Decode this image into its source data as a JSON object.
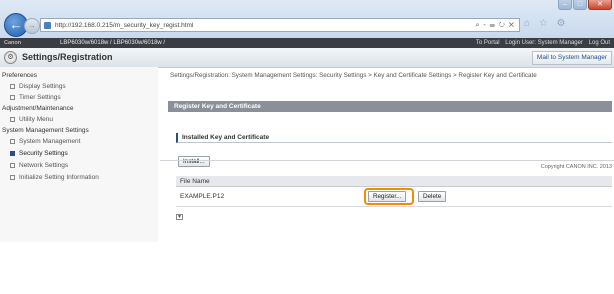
{
  "browser": {
    "url": "http://192.168.0.215/m_security_key_regist.html",
    "address_tools": "⌕ - ☰ ↻ ✕",
    "window_controls": {
      "minimize": "–",
      "maximize": "□",
      "close": "✕"
    },
    "toolbar_icons": "⌂ ☆ ⚙"
  },
  "header": {
    "logo": "Canon",
    "device": "LBP6030w/6018w / LBP6030w/6018w /",
    "to_portal": "To Portal",
    "login_user": "Login User: System Manager",
    "log_out": "Log Out"
  },
  "title_bar": {
    "title": "Settings/Registration",
    "mail_button": "Mail to System Manager"
  },
  "sidebar": {
    "preferences": "Preferences",
    "display_settings": "Display Settings",
    "timer_settings": "Timer Settings",
    "adjustment": "Adjustment/Maintenance",
    "utility_menu": "Utility Menu",
    "system_mgmt": "System Management Settings",
    "system_management": "System Management",
    "security_settings": "Security Settings",
    "network_settings": "Network Settings",
    "initialize": "Initialize Setting Information"
  },
  "main": {
    "breadcrumb": "Settings/Registration: System Management Settings: Security Settings > Key and Certificate Settings > Register Key and Certificate",
    "section_title": "Register Key and Certificate",
    "subsection_title": "Installed Key and Certificate",
    "install_button": "Install...",
    "column_file_name": "File Name",
    "file_name": "EXAMPLE.P12",
    "register_button": "Register...",
    "delete_button": "Delete",
    "scroll_icon": "▼",
    "copyright": "Copyright CANON INC. 2013"
  },
  "colors": {
    "highlight": "#f28c00",
    "section_bar": "#8a8f99",
    "active_nav": "#2a4e8a"
  }
}
